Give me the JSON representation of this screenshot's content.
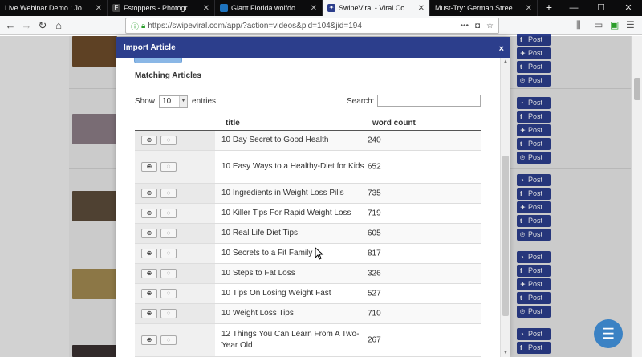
{
  "browser": {
    "tabs": [
      {
        "title": "Live Webinar Demo : Job Videos",
        "fav_color": "#d23f31",
        "active": false
      },
      {
        "title": "Fstoppers - Photography Ne",
        "fav_color": "#444444",
        "active": false
      },
      {
        "title": "Giant Florida wolfdog goes",
        "fav_color": "#1e73be",
        "active": false
      },
      {
        "title": "SwipeViral - Viral Content at",
        "fav_color": "#2c3e8c",
        "active": true
      },
      {
        "title": "Must-Try: German Street Food",
        "fav_color": "#888888",
        "active": false
      }
    ],
    "new_tab": "+",
    "window_controls": [
      "—",
      "☐",
      "✕"
    ],
    "url": "https://swipeviral.com/app/?action=videos&pid=104&jid=194"
  },
  "page": {
    "social_labels": [
      "Post",
      "Post",
      "Post",
      "Post",
      "Post"
    ]
  },
  "modal": {
    "title": "Import Article",
    "close": "×",
    "section_title": "Matching Articles",
    "show_label": "Show",
    "entries_value": "10",
    "entries_label": "entries",
    "search_label": "Search:",
    "search_value": "",
    "columns": {
      "title": "title",
      "word_count": "word count"
    },
    "add_symbol": "⊕",
    "loading_symbol": "◌",
    "rows": [
      {
        "title": "10 Day Secret to Good Health",
        "word_count": "240"
      },
      {
        "title": "10 Easy Ways to a Healthy-Diet for Kids",
        "word_count": "652"
      },
      {
        "title": "10 Ingredients in Weight Loss Pills",
        "word_count": "735"
      },
      {
        "title": "10 Killer Tips For Rapid Weight Loss",
        "word_count": "719"
      },
      {
        "title": "10 Real Life Diet Tips",
        "word_count": "605"
      },
      {
        "title": "10 Secrets to a Fit Family",
        "word_count": "817"
      },
      {
        "title": "10 Steps to Fat Loss",
        "word_count": "326"
      },
      {
        "title": "10 Tips On Losing Weight Fast",
        "word_count": "527"
      },
      {
        "title": "10 Weight Loss Tips",
        "word_count": "710"
      },
      {
        "title": "12 Things You Can Learn From A Two-Year Old",
        "word_count": "267"
      }
    ]
  },
  "colors": {
    "brand": "#2c3e8c",
    "accent_button": "#8ab7e6",
    "chat": "#3b82c4"
  }
}
